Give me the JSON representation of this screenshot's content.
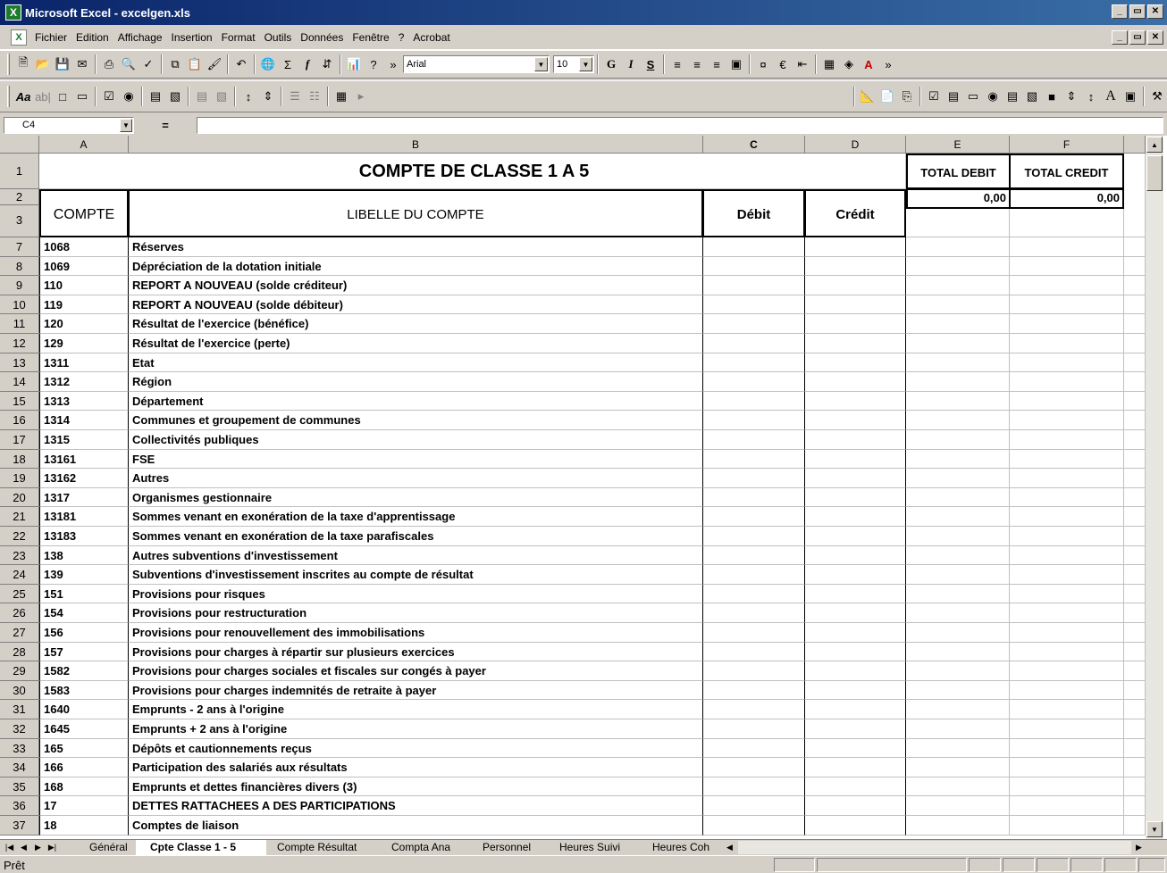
{
  "window": {
    "title": "Microsoft Excel - excelgen.xls"
  },
  "menu": [
    "Fichier",
    "Edition",
    "Affichage",
    "Insertion",
    "Format",
    "Outils",
    "Données",
    "Fenêtre",
    "?",
    "Acrobat"
  ],
  "toolbar": {
    "font_name": "Arial",
    "font_size": "10"
  },
  "formula_bar": {
    "name_box": "C4",
    "equals": "=",
    "formula": ""
  },
  "columns": [
    "A",
    "B",
    "C",
    "D",
    "E",
    "F"
  ],
  "sheet": {
    "title": "COMPTE DE CLASSE 1 A 5",
    "total_debit_label": "TOTAL DEBIT",
    "total_credit_label": "TOTAL CREDIT",
    "total_debit_value": "0,00",
    "total_credit_value": "0,00",
    "header_compte": "COMPTE",
    "header_libelle": "LIBELLE DU COMPTE",
    "header_debit": "Débit",
    "header_credit": "Crédit",
    "header_rows": [
      "1",
      "2",
      "3"
    ],
    "rows": [
      {
        "row": "7",
        "compte": "1068",
        "libelle": "Réserves"
      },
      {
        "row": "8",
        "compte": "1069",
        "libelle": "Dépréciation de la dotation initiale"
      },
      {
        "row": "9",
        "compte": "110",
        "libelle": "REPORT A NOUVEAU (solde créditeur)"
      },
      {
        "row": "10",
        "compte": "119",
        "libelle": "REPORT A NOUVEAU (solde débiteur)"
      },
      {
        "row": "11",
        "compte": "120",
        "libelle": "Résultat de l'exercice (bénéfice)"
      },
      {
        "row": "12",
        "compte": "129",
        "libelle": "Résultat de l'exercice (perte)"
      },
      {
        "row": "13",
        "compte": "1311",
        "libelle": "Etat"
      },
      {
        "row": "14",
        "compte": "1312",
        "libelle": "Région"
      },
      {
        "row": "15",
        "compte": "1313",
        "libelle": "Département"
      },
      {
        "row": "16",
        "compte": "1314",
        "libelle": "Communes et groupement de communes"
      },
      {
        "row": "17",
        "compte": "1315",
        "libelle": "Collectivités publiques"
      },
      {
        "row": "18",
        "compte": "13161",
        "libelle": "FSE"
      },
      {
        "row": "19",
        "compte": "13162",
        "libelle": "Autres"
      },
      {
        "row": "20",
        "compte": "1317",
        "libelle": "Organismes gestionnaire"
      },
      {
        "row": "21",
        "compte": "13181",
        "libelle": "Sommes venant en exonération de la taxe d'apprentissage"
      },
      {
        "row": "22",
        "compte": "13183",
        "libelle": "Sommes venant en exonération de la taxe parafiscales"
      },
      {
        "row": "23",
        "compte": "138",
        "libelle": "Autres subventions d'investissement"
      },
      {
        "row": "24",
        "compte": "139",
        "libelle": "Subventions d'investissement inscrites au compte de résultat"
      },
      {
        "row": "25",
        "compte": "151",
        "libelle": "Provisions pour risques"
      },
      {
        "row": "26",
        "compte": "154",
        "libelle": "Provisions pour restructuration"
      },
      {
        "row": "27",
        "compte": "156",
        "libelle": "Provisions pour renouvellement des immobilisations"
      },
      {
        "row": "28",
        "compte": "157",
        "libelle": "Provisions pour charges à répartir sur plusieurs exercices"
      },
      {
        "row": "29",
        "compte": "1582",
        "libelle": "Provisions pour charges sociales et fiscales sur congés à payer"
      },
      {
        "row": "30",
        "compte": "1583",
        "libelle": "Provisions pour charges indemnités de retraite à payer"
      },
      {
        "row": "31",
        "compte": "1640",
        "libelle": "Emprunts - 2 ans à l'origine"
      },
      {
        "row": "32",
        "compte": "1645",
        "libelle": "Emprunts + 2 ans à l'origine"
      },
      {
        "row": "33",
        "compte": "165",
        "libelle": "Dépôts et cautionnements reçus"
      },
      {
        "row": "34",
        "compte": "166",
        "libelle": "Participation des salariés aux résultats"
      },
      {
        "row": "35",
        "compte": "168",
        "libelle": "Emprunts et dettes financières divers (3)"
      },
      {
        "row": "36",
        "compte": "17",
        "libelle": "DETTES RATTACHEES A DES PARTICIPATIONS"
      },
      {
        "row": "37",
        "compte": "18",
        "libelle": "Comptes de liaison"
      }
    ]
  },
  "sheet_tabs": [
    "Général",
    "Cpte Classe 1 - 5",
    "Compte Résultat",
    "Compta Ana",
    "Personnel",
    "Heures Suivi",
    "Heures Coh"
  ],
  "active_tab_index": 1,
  "status": {
    "text": "Prêt"
  }
}
